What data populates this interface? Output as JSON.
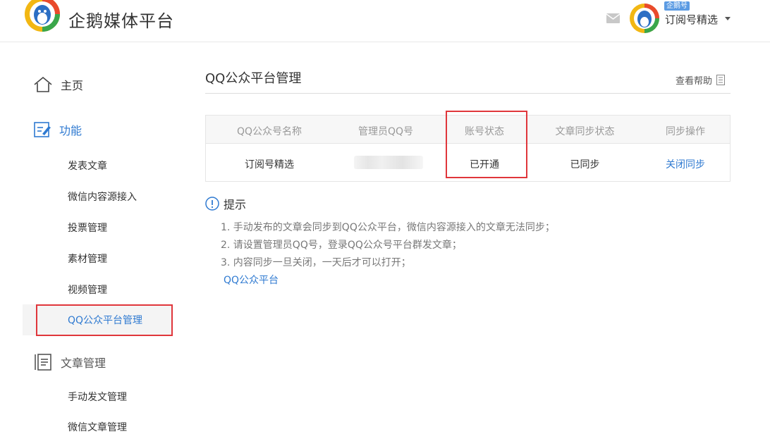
{
  "header": {
    "brand": "企鹅媒体平台",
    "account_badge": "企鹅号",
    "account_name": "订阅号精选"
  },
  "sidebar": {
    "home": "主页",
    "functions": "功能",
    "function_items": [
      "发表文章",
      "微信内容源接入",
      "投票管理",
      "素材管理",
      "视频管理",
      "QQ公众平台管理"
    ],
    "article_mgmt": "文章管理",
    "article_items": [
      "手动发文管理",
      "微信文章管理"
    ]
  },
  "main": {
    "title": "QQ公众平台管理",
    "help": "查看帮助",
    "table": {
      "headers": [
        "QQ公众号名称",
        "管理员QQ号",
        "账号状态",
        "文章同步状态",
        "同步操作"
      ],
      "row": {
        "name": "订阅号精选",
        "admin_qq": "",
        "account_status": "已开通",
        "sync_status": "已同步",
        "action": "关闭同步"
      }
    },
    "tips": {
      "title": "提示",
      "items": [
        "1.  手动发布的文章会同步到QQ公众平台，微信内容源接入的文章无法同步；",
        "2.  请设置管理员QQ号，登录QQ公众号平台群发文章；",
        "3.  内容同步一旦关闭，一天后才可以打开；"
      ],
      "link": "QQ公众平台"
    }
  },
  "colors": {
    "accent": "#2f7ad1",
    "highlight": "#e0363b"
  }
}
